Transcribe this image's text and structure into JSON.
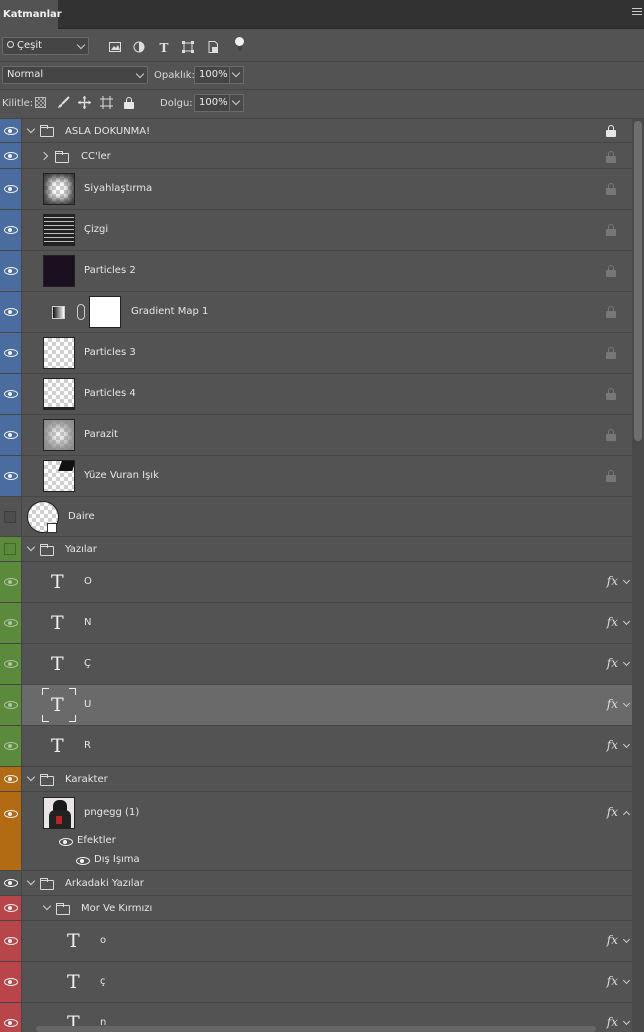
{
  "panel": {
    "tab_title": "Katmanlar"
  },
  "filter": {
    "kind_label": "Çeşit"
  },
  "blend": {
    "mode": "Normal",
    "opacity_label": "Opaklık:",
    "opacity_value": "100%"
  },
  "lock": {
    "label": "Kilitle:",
    "fill_label": "Dolgu:",
    "fill_value": "100%"
  },
  "layers": [
    {
      "name": "ASLA DOKUNMA!"
    },
    {
      "name": "CC'ler"
    },
    {
      "name": "Siyahlaştırma"
    },
    {
      "name": "Çizgi"
    },
    {
      "name": "Particles 2"
    },
    {
      "name": "Gradient Map 1"
    },
    {
      "name": "Particles 3"
    },
    {
      "name": "Particles 4"
    },
    {
      "name": "Parazit"
    },
    {
      "name": "Yüze Vuran Işık"
    },
    {
      "name": "Daire"
    },
    {
      "name": "Yazılar"
    },
    {
      "name": "O"
    },
    {
      "name": "N"
    },
    {
      "name": "Ç"
    },
    {
      "name": "U"
    },
    {
      "name": "R"
    },
    {
      "name": "Karakter"
    },
    {
      "name": "pngegg (1)"
    },
    {
      "name": "Efektler"
    },
    {
      "name": "Dış Işıma"
    },
    {
      "name": "Arkadaki Yazılar"
    },
    {
      "name": "Mor Ve Kırmızı"
    },
    {
      "name": "o"
    },
    {
      "name": "ç"
    },
    {
      "name": "n"
    }
  ],
  "colors": {
    "blue_tag": "#4a6c9e",
    "green_tag": "#5c8a3c",
    "orange_tag": "#b26b12",
    "red_tag": "#b8454a"
  },
  "text_layer_glyph": "T",
  "fx_label": "fx"
}
